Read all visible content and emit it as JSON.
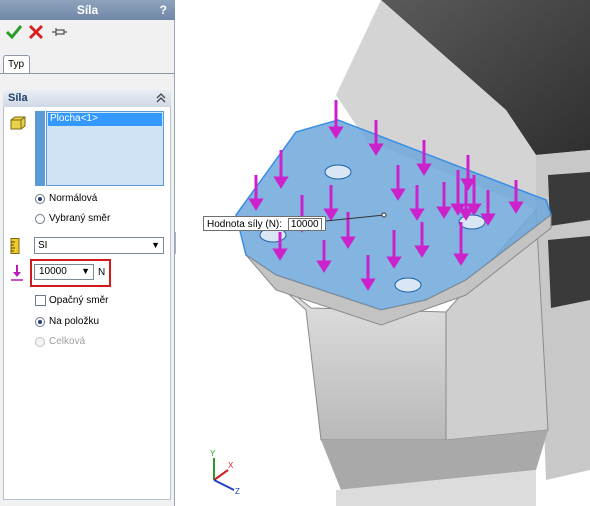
{
  "panel": {
    "title": "Síla",
    "help": "?",
    "tab_label": "Typ",
    "group_title": "Síla",
    "selection_item": "Plocha<1>",
    "direction_options": [
      {
        "label": "Normálová",
        "selected": true
      },
      {
        "label": "Vybraný směr",
        "selected": false
      }
    ],
    "unit_system": "SI",
    "force_value": "10000",
    "force_unit": "N",
    "reverse_label": "Opačný směr",
    "reverse_checked": false,
    "distribution_options": [
      {
        "label": "Na položku",
        "selected": true,
        "enabled": true
      },
      {
        "label": "Celková",
        "selected": false,
        "enabled": false
      }
    ]
  },
  "viewport": {
    "callout_label": "Hodnota síly (N):",
    "callout_value": "10000",
    "triad_axes": [
      "X",
      "Y",
      "Z"
    ]
  },
  "colors": {
    "accent": "#3399ff",
    "force_arrow": "#cc22cc",
    "highlight_face": "#6fa8dc",
    "title_bar": "#7f95b3",
    "emphasis_box": "#d2191c"
  }
}
